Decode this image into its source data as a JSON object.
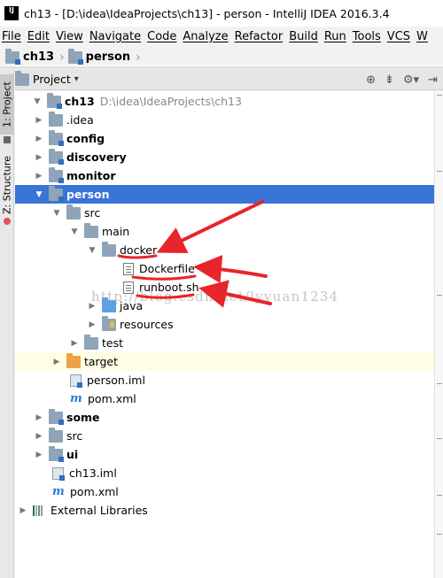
{
  "window": {
    "title": "ch13 - [D:\\idea\\IdeaProjects\\ch13] - person - IntelliJ IDEA 2016.3.4",
    "app_icon": "IJ"
  },
  "menu": [
    "File",
    "Edit",
    "View",
    "Navigate",
    "Code",
    "Analyze",
    "Refactor",
    "Build",
    "Run",
    "Tools",
    "VCS",
    "W"
  ],
  "breadcrumb": [
    "ch13",
    "person"
  ],
  "side_tabs": {
    "project": "1: Project",
    "structure": "Z: Structure"
  },
  "panel": {
    "title": "Project"
  },
  "tree": [
    {
      "label": "ch13",
      "path": "D:\\idea\\IdeaProjects\\ch13",
      "icon": "module-folder-icon",
      "expanded": true,
      "bold": true
    },
    {
      "label": ".idea",
      "icon": "folder-icon",
      "expanded": false
    },
    {
      "label": "config",
      "icon": "module-folder-icon",
      "expanded": false,
      "bold": true
    },
    {
      "label": "discovery",
      "icon": "module-folder-icon",
      "expanded": false,
      "bold": true
    },
    {
      "label": "monitor",
      "icon": "module-folder-icon",
      "expanded": false,
      "bold": true
    },
    {
      "label": "person",
      "icon": "module-folder-icon",
      "expanded": true,
      "bold": true,
      "selected": true
    },
    {
      "label": "src",
      "icon": "folder-icon",
      "expanded": true
    },
    {
      "label": "main",
      "icon": "folder-icon",
      "expanded": true
    },
    {
      "label": "docker",
      "icon": "folder-icon",
      "expanded": true
    },
    {
      "label": "Dockerfile",
      "icon": "text-file-icon"
    },
    {
      "label": "runboot.sh",
      "icon": "text-file-icon"
    },
    {
      "label": "java",
      "icon": "source-folder-icon",
      "expanded": false
    },
    {
      "label": "resources",
      "icon": "resources-folder-icon",
      "expanded": false
    },
    {
      "label": "test",
      "icon": "folder-icon",
      "expanded": false
    },
    {
      "label": "target",
      "icon": "excluded-folder-icon",
      "expanded": false,
      "highlight": true
    },
    {
      "label": "person.iml",
      "icon": "module-file-icon"
    },
    {
      "label": "pom.xml",
      "icon": "maven-icon"
    },
    {
      "label": "some",
      "icon": "module-folder-icon",
      "expanded": false,
      "bold": true
    },
    {
      "label": "src",
      "icon": "folder-icon",
      "expanded": false
    },
    {
      "label": "ui",
      "icon": "module-folder-icon",
      "expanded": false,
      "bold": true
    },
    {
      "label": "ch13.iml",
      "icon": "module-file-icon"
    },
    {
      "label": "pom.xml",
      "icon": "maven-icon"
    },
    {
      "label": "External Libraries",
      "icon": "libraries-icon",
      "expanded": false
    }
  ],
  "watermark": "http://blog.csdn.net/lyyuan1234",
  "colors": {
    "selection": "#3875d7",
    "annotation": "#e8242c",
    "highlight_row": "#fffde3"
  }
}
